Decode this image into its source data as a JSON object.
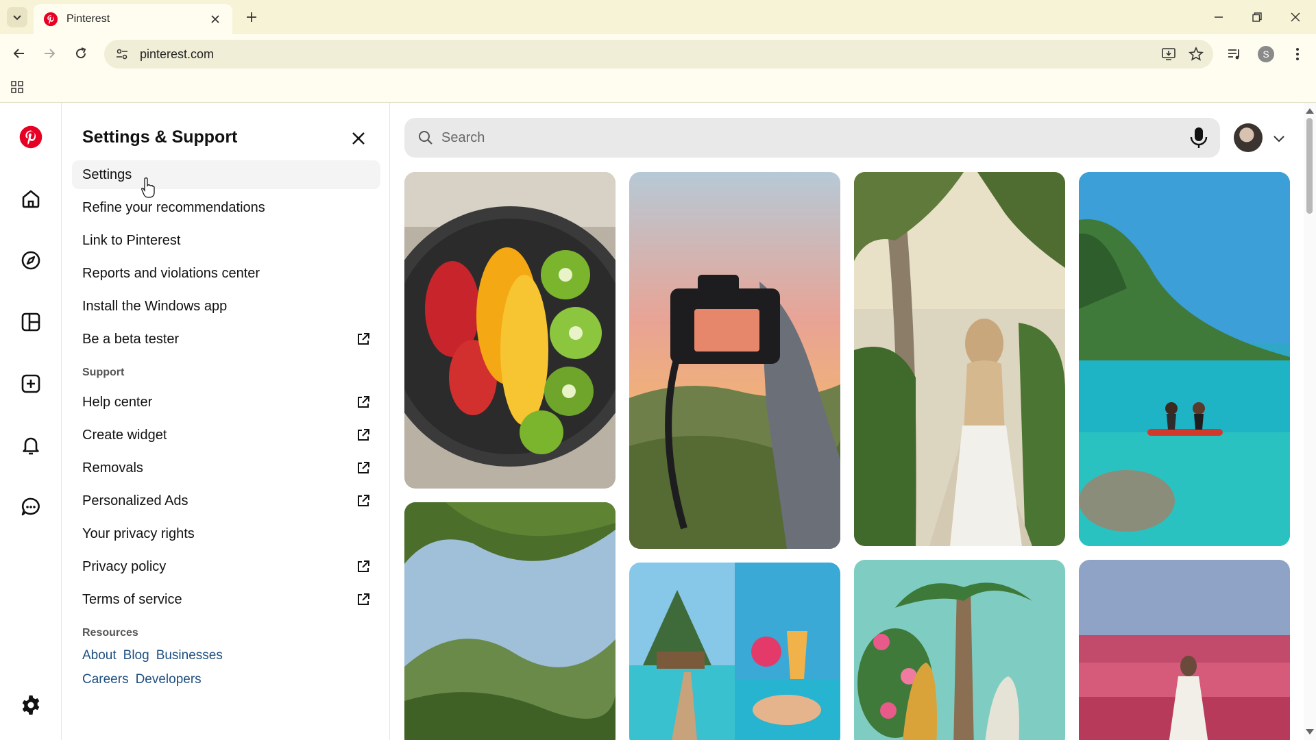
{
  "browser": {
    "tab_title": "Pinterest",
    "url": "pinterest.com"
  },
  "colors": {
    "pinterest_red": "#E60023",
    "link_blue": "#1C4E80",
    "chrome_bg": "#F6F3D6"
  },
  "rail": {
    "icons": [
      "pinterest-logo-icon",
      "home-icon",
      "explore-compass-icon",
      "boards-icon",
      "create-plus-icon",
      "notifications-bell-icon",
      "messages-chat-icon",
      "settings-gear-icon"
    ]
  },
  "panel": {
    "title": "Settings & Support",
    "items": [
      {
        "label": "Settings",
        "external": false
      },
      {
        "label": "Refine your recommendations",
        "external": false
      },
      {
        "label": "Link to Pinterest",
        "external": false
      },
      {
        "label": "Reports and violations center",
        "external": false
      },
      {
        "label": "Install the Windows app",
        "external": false
      },
      {
        "label": "Be a beta tester",
        "external": true
      }
    ],
    "support_label": "Support",
    "support_items": [
      {
        "label": "Help center",
        "external": true
      },
      {
        "label": "Create widget",
        "external": true
      },
      {
        "label": "Removals",
        "external": true
      },
      {
        "label": "Personalized Ads",
        "external": true
      },
      {
        "label": "Your privacy rights",
        "external": false
      },
      {
        "label": "Privacy policy",
        "external": true
      },
      {
        "label": "Terms of service",
        "external": true
      }
    ],
    "resources_label": "Resources",
    "resources_row1": [
      "About",
      "Blog",
      "Businesses"
    ],
    "resources_row2": [
      "Careers",
      "Developers"
    ]
  },
  "search": {
    "placeholder": "Search"
  }
}
